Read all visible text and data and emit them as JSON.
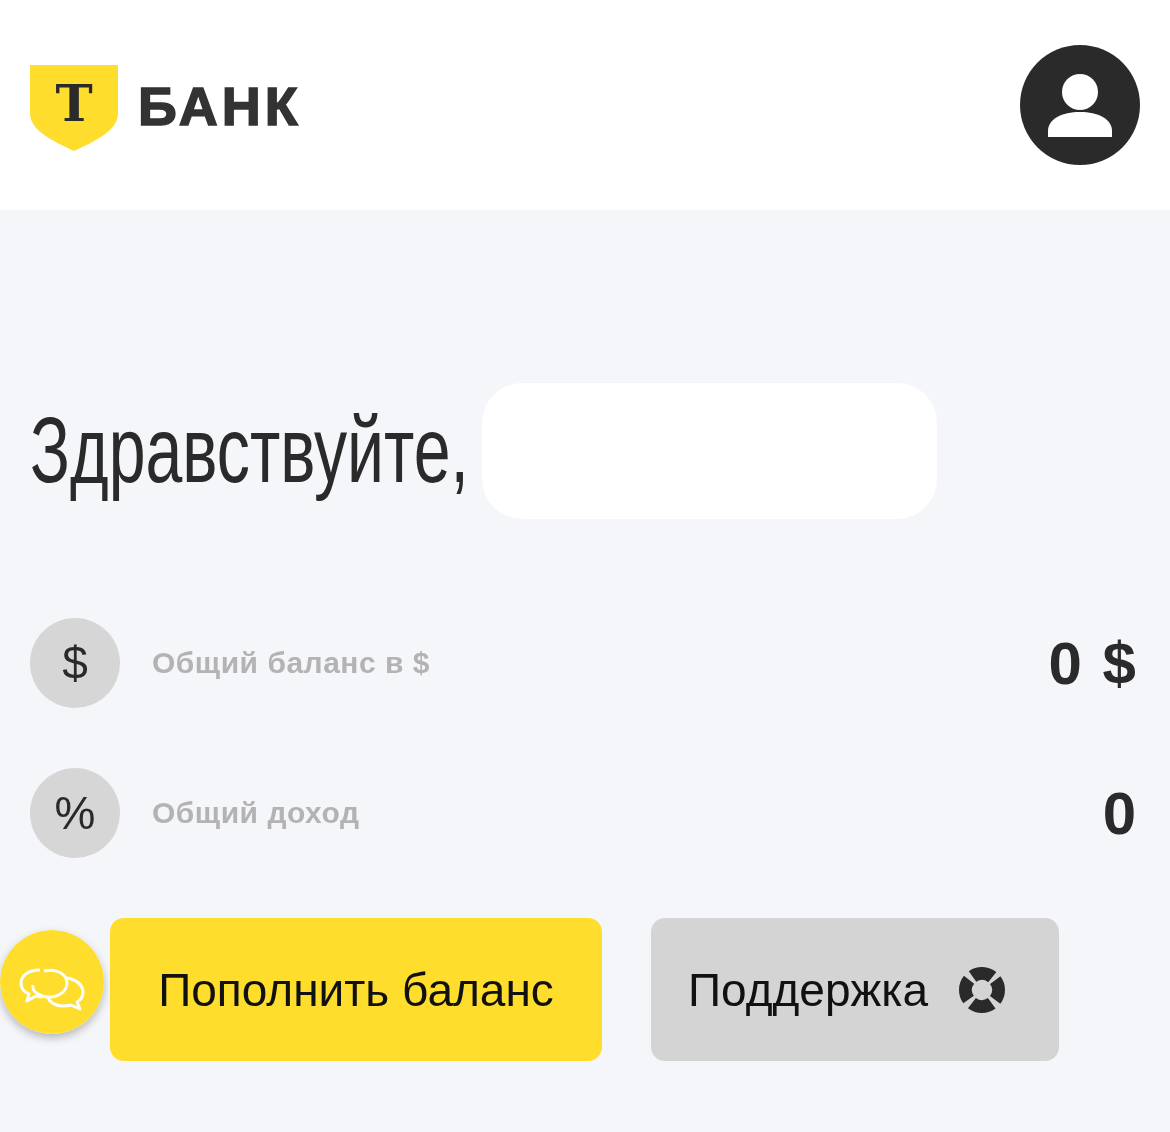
{
  "header": {
    "logo": {
      "letter": "Т",
      "wordmark": "БАНК"
    }
  },
  "greeting": {
    "text": "Здравствуйте,",
    "name_redacted": true
  },
  "stats": [
    {
      "symbol": "$",
      "label": "Общий баланс в $",
      "value": "0 $"
    },
    {
      "symbol": "%",
      "label": "Общий доход",
      "value": "0"
    }
  ],
  "actions": [
    {
      "kind": "primary",
      "label": "Пополнить баланс"
    },
    {
      "kind": "secondary",
      "label": "Поддержка"
    }
  ]
}
